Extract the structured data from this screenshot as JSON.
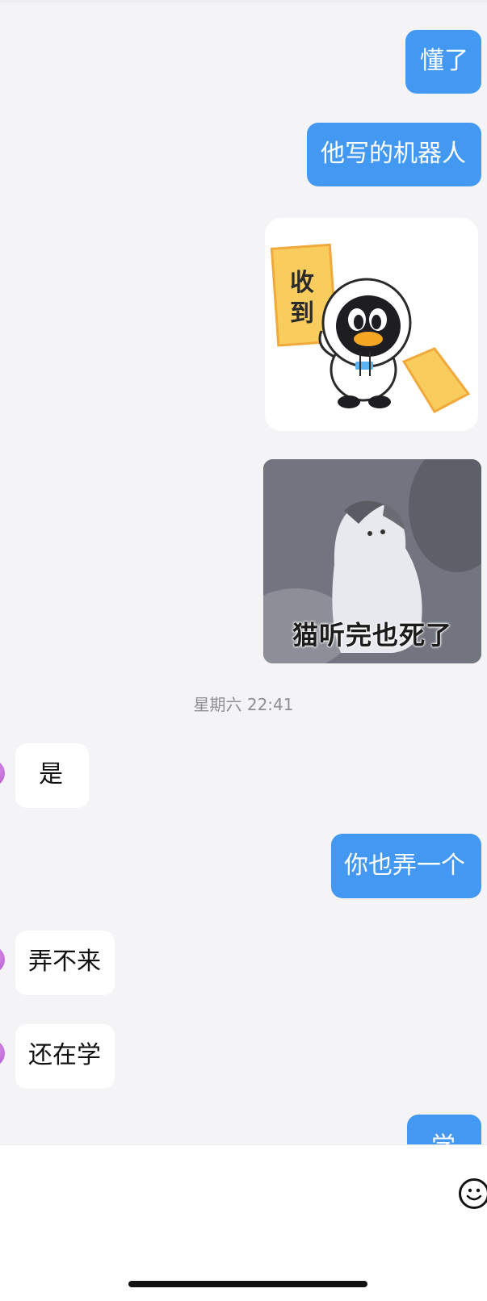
{
  "messages": [
    {
      "side": "outgoing",
      "text": "懂了"
    },
    {
      "side": "outgoing",
      "text": "他写的机器人"
    },
    {
      "side": "outgoing",
      "sticker": "penguin-astronaut-sticker",
      "sticker_text": "收到"
    },
    {
      "side": "outgoing",
      "image": "cat-meme",
      "image_caption": "猫听完也死了"
    },
    {
      "timestamp": "星期六 22:41"
    },
    {
      "side": "incoming",
      "text": "是"
    },
    {
      "side": "outgoing",
      "text": "你也弄一个"
    },
    {
      "side": "incoming",
      "text": "弄不来"
    },
    {
      "side": "incoming",
      "text": "还在学"
    },
    {
      "side": "outgoing",
      "text": "学"
    }
  ],
  "colors": {
    "outgoing_bubble": "#4399f2",
    "incoming_bubble": "#ffffff",
    "background": "#f4f4f6"
  },
  "input_bar": {
    "placeholder": "",
    "icons": [
      "emoji-icon"
    ]
  }
}
